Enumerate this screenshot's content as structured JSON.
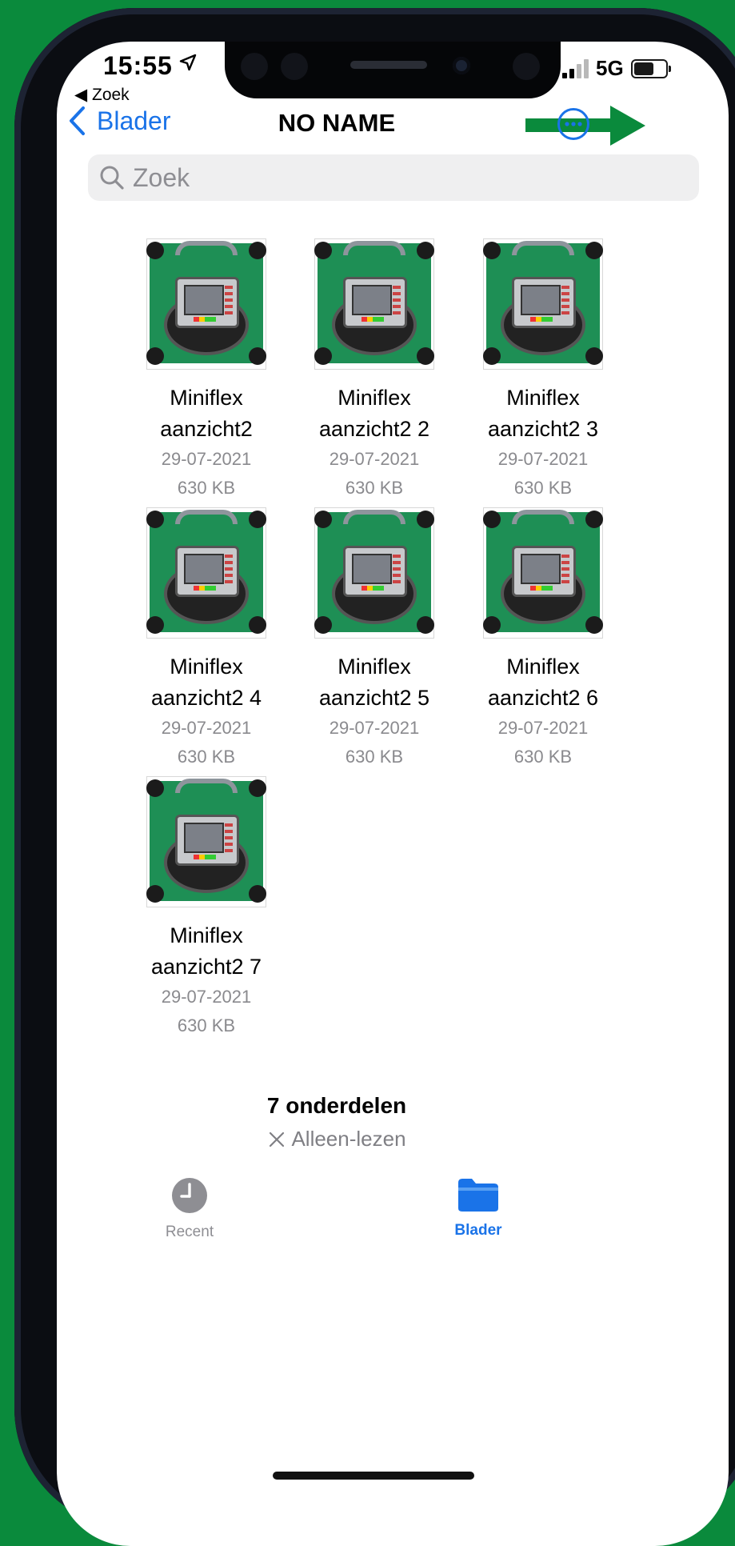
{
  "status_bar": {
    "time": "15:55",
    "back_app": "Zoek",
    "network": "5G"
  },
  "nav": {
    "back_label": "Blader",
    "title": "NO NAME"
  },
  "search": {
    "placeholder": "Zoek"
  },
  "files": [
    {
      "name_line1": "Miniflex",
      "name_line2": "aanzicht2",
      "date": "29-07-2021",
      "size": "630 KB"
    },
    {
      "name_line1": "Miniflex",
      "name_line2": "aanzicht2 2",
      "date": "29-07-2021",
      "size": "630 KB"
    },
    {
      "name_line1": "Miniflex",
      "name_line2": "aanzicht2 3",
      "date": "29-07-2021",
      "size": "630 KB"
    },
    {
      "name_line1": "Miniflex",
      "name_line2": "aanzicht2 4",
      "date": "29-07-2021",
      "size": "630 KB"
    },
    {
      "name_line1": "Miniflex",
      "name_line2": "aanzicht2 5",
      "date": "29-07-2021",
      "size": "630 KB"
    },
    {
      "name_line1": "Miniflex",
      "name_line2": "aanzicht2 6",
      "date": "29-07-2021",
      "size": "630 KB"
    },
    {
      "name_line1": "Miniflex",
      "name_line2": "aanzicht2 7",
      "date": "29-07-2021",
      "size": "630 KB"
    }
  ],
  "footer": {
    "count": "7 onderdelen",
    "readonly": "Alleen-lezen"
  },
  "tabs": [
    {
      "label": "Recent",
      "icon": "clock-icon",
      "color": "#8e8e93"
    },
    {
      "label": "Blader",
      "icon": "folder-icon",
      "color": "#1a73e8"
    }
  ],
  "colors": {
    "accent": "#1a73e8",
    "annotation_arrow": "#0a8a3c",
    "background": "#0a8a3c"
  }
}
